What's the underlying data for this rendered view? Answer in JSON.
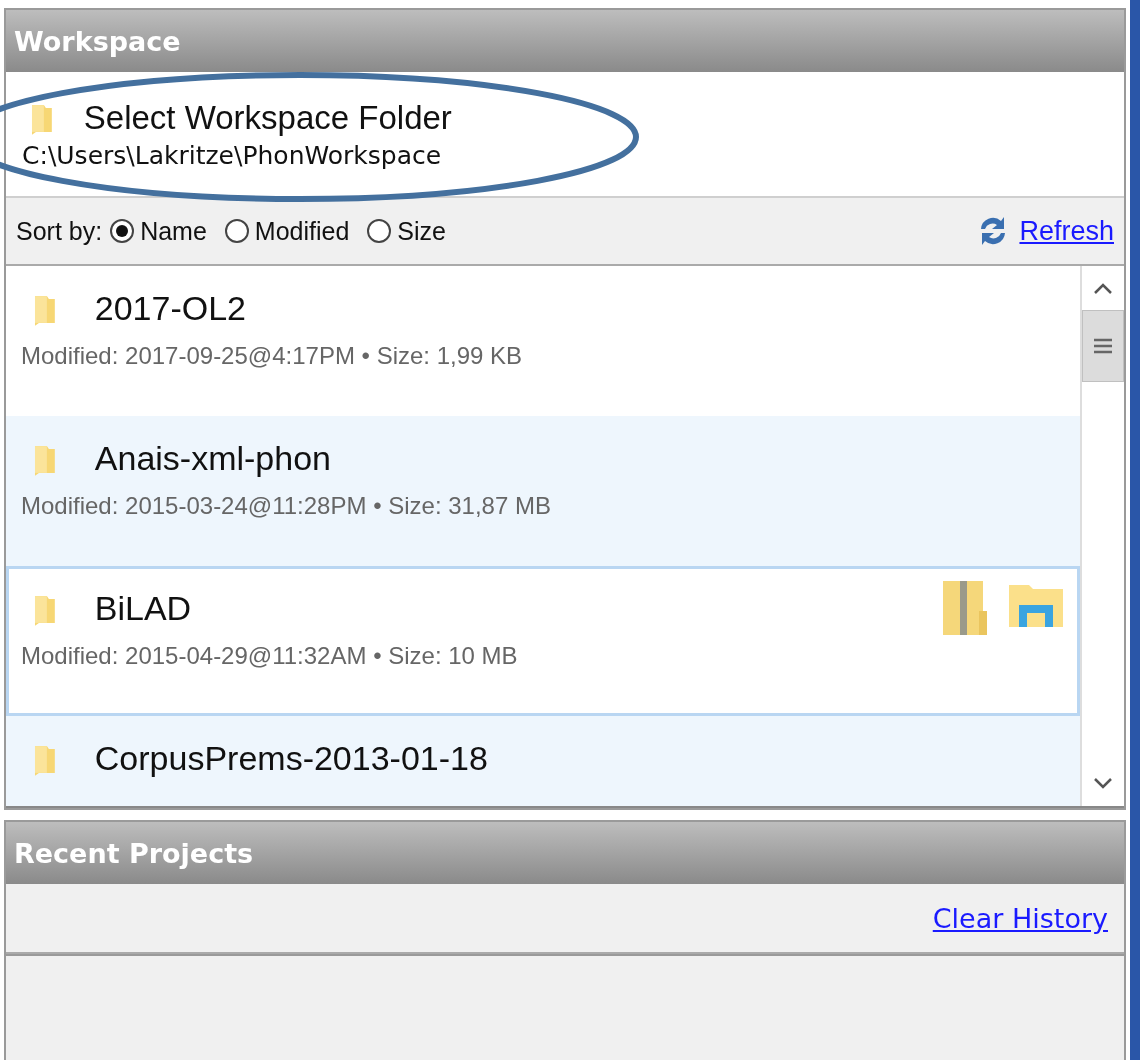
{
  "workspace": {
    "title": "Workspace",
    "select_label": "Select Workspace Folder",
    "path": "C:\\Users\\Lakritze\\PhonWorkspace",
    "sort_label": "Sort by:",
    "sort_options": [
      {
        "label": "Name",
        "selected": true
      },
      {
        "label": "Modified",
        "selected": false
      },
      {
        "label": "Size",
        "selected": false
      }
    ],
    "refresh": "Refresh",
    "folders": [
      {
        "name": "2017-OL2",
        "meta": "Modified: 2017-09-25@4:17PM • Size: 1,99 KB",
        "selected": false
      },
      {
        "name": "Anais-xml-phon",
        "meta": "Modified: 2015-03-24@11:28PM • Size: 31,87 MB",
        "selected": false
      },
      {
        "name": "BiLAD",
        "meta": "Modified: 2015-04-29@11:32AM • Size: 10 MB",
        "selected": true
      },
      {
        "name": "CorpusPrems-2013-01-18",
        "selected": false
      }
    ]
  },
  "recent_projects": {
    "title": "Recent Projects",
    "clear": "Clear History"
  }
}
